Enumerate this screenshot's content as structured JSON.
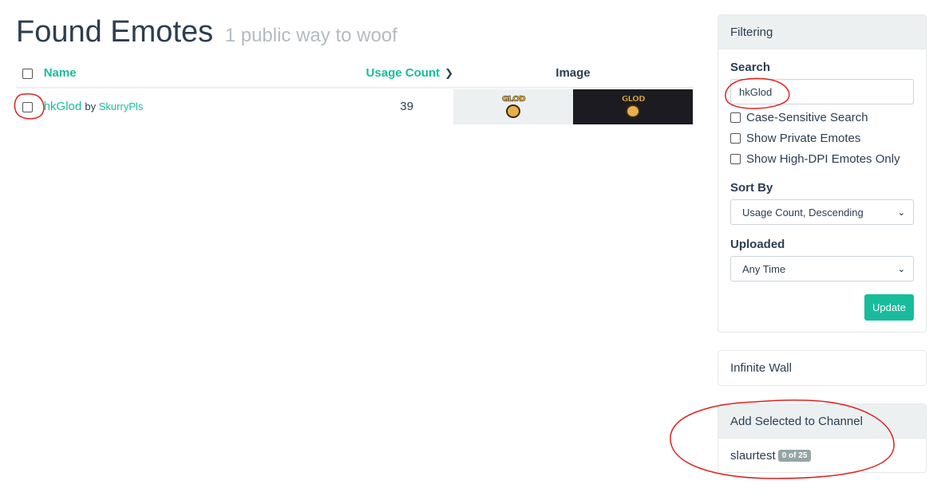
{
  "header": {
    "title": "Found Emotes",
    "subtitle": "1 public way to woof"
  },
  "table": {
    "columns": {
      "name": "Name",
      "usage": "Usage Count",
      "image": "Image"
    },
    "rows": [
      {
        "name": "hkGlod",
        "by_word": "by",
        "author": "SkurryPls",
        "usage_count": "39",
        "image_text": "GLOD"
      }
    ]
  },
  "filtering": {
    "heading": "Filtering",
    "search_label": "Search",
    "search_value": "hkGlod",
    "options": [
      {
        "label": "Case-Sensitive Search",
        "checked": false
      },
      {
        "label": "Show Private Emotes",
        "checked": false
      },
      {
        "label": "Show High-DPI Emotes Only",
        "checked": false
      }
    ],
    "sort_label": "Sort By",
    "sort_value": "Usage Count, Descending",
    "uploaded_label": "Uploaded",
    "uploaded_value": "Any Time",
    "update_button": "Update"
  },
  "infinite_wall": {
    "label": "Infinite Wall"
  },
  "add_to_channel": {
    "heading": "Add Selected to Channel",
    "channel": "slaurtest",
    "badge": "0 of 25"
  },
  "colors": {
    "accent": "#18bc9c",
    "text": "#2c3e50",
    "muted": "#b4bcc2",
    "panel_heading_bg": "#ecf0f1",
    "annotation": "#e02020"
  },
  "icons": {
    "sort": "chevron-down-icon",
    "select_arrow": "chevron-down-icon"
  }
}
